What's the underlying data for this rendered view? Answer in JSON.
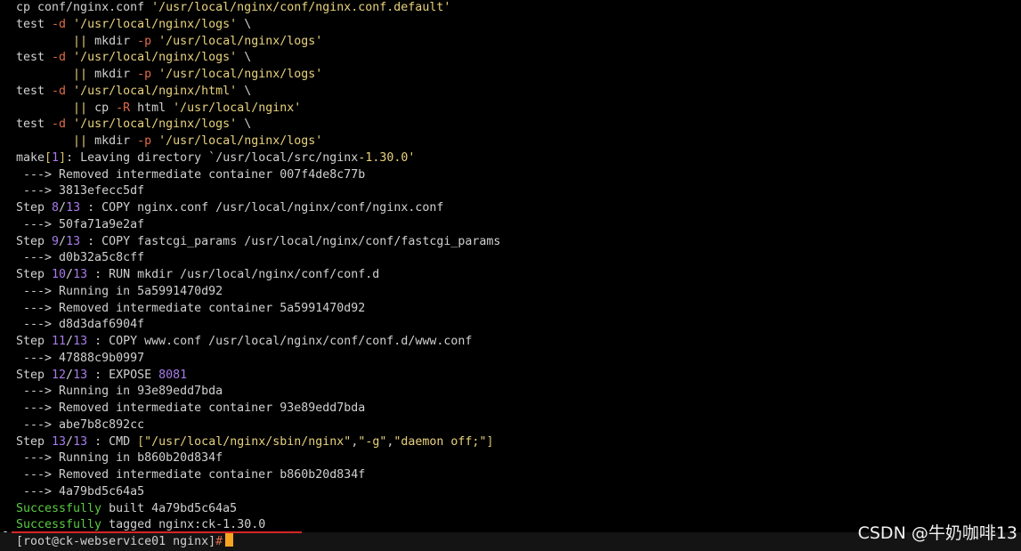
{
  "colors": {
    "default": "#d0d0d0",
    "string": "#e8d27c",
    "flag": "#e06c4a",
    "number": "#a77bea",
    "success": "#5ccb43",
    "bracket": "#d6c36a",
    "cursor": "#f7a521",
    "underline": "#d62525",
    "hostbar": "#141414"
  },
  "terminal": {
    "lines": [
      [
        {
          "t": "cp conf/nginx.conf ",
          "c": "default"
        },
        {
          "t": "'/usr/local/nginx/conf/nginx.conf.default'",
          "c": "string"
        }
      ],
      [
        {
          "t": "test ",
          "c": "default"
        },
        {
          "t": "-d",
          "c": "flag"
        },
        {
          "t": " ",
          "c": "default"
        },
        {
          "t": "'/usr/local/nginx/logs'",
          "c": "string"
        },
        {
          "t": " \\",
          "c": "default"
        }
      ],
      [
        {
          "t": "        ",
          "c": "default"
        },
        {
          "t": "||",
          "c": "string"
        },
        {
          "t": " mkdir ",
          "c": "default"
        },
        {
          "t": "-p",
          "c": "flag"
        },
        {
          "t": " ",
          "c": "default"
        },
        {
          "t": "'/usr/local/nginx/logs'",
          "c": "string"
        }
      ],
      [
        {
          "t": "test ",
          "c": "default"
        },
        {
          "t": "-d",
          "c": "flag"
        },
        {
          "t": " ",
          "c": "default"
        },
        {
          "t": "'/usr/local/nginx/logs'",
          "c": "string"
        },
        {
          "t": " \\",
          "c": "default"
        }
      ],
      [
        {
          "t": "        ",
          "c": "default"
        },
        {
          "t": "||",
          "c": "string"
        },
        {
          "t": " mkdir ",
          "c": "default"
        },
        {
          "t": "-p",
          "c": "flag"
        },
        {
          "t": " ",
          "c": "default"
        },
        {
          "t": "'/usr/local/nginx/logs'",
          "c": "string"
        }
      ],
      [
        {
          "t": "test ",
          "c": "default"
        },
        {
          "t": "-d",
          "c": "flag"
        },
        {
          "t": " ",
          "c": "default"
        },
        {
          "t": "'/usr/local/nginx/html'",
          "c": "string"
        },
        {
          "t": " \\",
          "c": "default"
        }
      ],
      [
        {
          "t": "        ",
          "c": "default"
        },
        {
          "t": "||",
          "c": "string"
        },
        {
          "t": " cp ",
          "c": "default"
        },
        {
          "t": "-R",
          "c": "flag"
        },
        {
          "t": " html ",
          "c": "default"
        },
        {
          "t": "'/usr/local/nginx'",
          "c": "string"
        }
      ],
      [
        {
          "t": "test ",
          "c": "default"
        },
        {
          "t": "-d",
          "c": "flag"
        },
        {
          "t": " ",
          "c": "default"
        },
        {
          "t": "'/usr/local/nginx/logs'",
          "c": "string"
        },
        {
          "t": " \\",
          "c": "default"
        }
      ],
      [
        {
          "t": "        ",
          "c": "default"
        },
        {
          "t": "||",
          "c": "string"
        },
        {
          "t": " mkdir ",
          "c": "default"
        },
        {
          "t": "-p",
          "c": "flag"
        },
        {
          "t": " ",
          "c": "default"
        },
        {
          "t": "'/usr/local/nginx/logs'",
          "c": "string"
        }
      ],
      [
        {
          "t": "make",
          "c": "default"
        },
        {
          "t": "[",
          "c": "bracket"
        },
        {
          "t": "1",
          "c": "number"
        },
        {
          "t": "]",
          "c": "bracket"
        },
        {
          "t": ": Leaving directory `/usr/local/src/nginx",
          "c": "default"
        },
        {
          "t": "-1.30.0",
          "c": "string"
        },
        {
          "t": "'",
          "c": "string"
        }
      ],
      [
        {
          "t": " ---> Removed intermediate container 007f4de8c77b",
          "c": "default"
        }
      ],
      [
        {
          "t": " ---> 3813efecc5df",
          "c": "default"
        }
      ],
      [
        {
          "t": "Step ",
          "c": "default"
        },
        {
          "t": "8",
          "c": "number"
        },
        {
          "t": "/",
          "c": "default"
        },
        {
          "t": "13",
          "c": "number"
        },
        {
          "t": " : COPY nginx.conf /usr/local/nginx/conf/nginx.conf",
          "c": "default"
        }
      ],
      [
        {
          "t": " ---> 50fa71a9e2af",
          "c": "default"
        }
      ],
      [
        {
          "t": "Step ",
          "c": "default"
        },
        {
          "t": "9",
          "c": "number"
        },
        {
          "t": "/",
          "c": "default"
        },
        {
          "t": "13",
          "c": "number"
        },
        {
          "t": " : COPY fastcgi_params /usr/local/nginx/conf/fastcgi_params",
          "c": "default"
        }
      ],
      [
        {
          "t": " ---> d0b32a5c8cff",
          "c": "default"
        }
      ],
      [
        {
          "t": "Step ",
          "c": "default"
        },
        {
          "t": "10",
          "c": "number"
        },
        {
          "t": "/",
          "c": "default"
        },
        {
          "t": "13",
          "c": "number"
        },
        {
          "t": " : RUN mkdir /usr/local/nginx/conf/conf.d",
          "c": "default"
        }
      ],
      [
        {
          "t": " ---> Running in 5a5991470d92",
          "c": "default"
        }
      ],
      [
        {
          "t": " ---> Removed intermediate container 5a5991470d92",
          "c": "default"
        }
      ],
      [
        {
          "t": " ---> d8d3daf6904f",
          "c": "default"
        }
      ],
      [
        {
          "t": "Step ",
          "c": "default"
        },
        {
          "t": "11",
          "c": "number"
        },
        {
          "t": "/",
          "c": "default"
        },
        {
          "t": "13",
          "c": "number"
        },
        {
          "t": " : COPY www.conf /usr/local/nginx/conf/conf.d/www.conf",
          "c": "default"
        }
      ],
      [
        {
          "t": " ---> 47888c9b0997",
          "c": "default"
        }
      ],
      [
        {
          "t": "Step ",
          "c": "default"
        },
        {
          "t": "12",
          "c": "number"
        },
        {
          "t": "/",
          "c": "default"
        },
        {
          "t": "13",
          "c": "number"
        },
        {
          "t": " : EXPOSE ",
          "c": "default"
        },
        {
          "t": "8081",
          "c": "number"
        }
      ],
      [
        {
          "t": " ---> Running in 93e89edd7bda",
          "c": "default"
        }
      ],
      [
        {
          "t": " ---> Removed intermediate container 93e89edd7bda",
          "c": "default"
        }
      ],
      [
        {
          "t": " ---> abe7b8c892cc",
          "c": "default"
        }
      ],
      [
        {
          "t": "Step ",
          "c": "default"
        },
        {
          "t": "13",
          "c": "number"
        },
        {
          "t": "/",
          "c": "default"
        },
        {
          "t": "13",
          "c": "number"
        },
        {
          "t": " : CMD ",
          "c": "default"
        },
        {
          "t": "[",
          "c": "bracket"
        },
        {
          "t": "\"/usr/local/nginx/sbin/nginx\"",
          "c": "string"
        },
        {
          "t": ",",
          "c": "default"
        },
        {
          "t": "\"-g\"",
          "c": "string"
        },
        {
          "t": ",",
          "c": "default"
        },
        {
          "t": "\"daemon off;\"",
          "c": "string"
        },
        {
          "t": "]",
          "c": "bracket"
        }
      ],
      [
        {
          "t": " ---> Running in b860b20d834f",
          "c": "default"
        }
      ],
      [
        {
          "t": " ---> Removed intermediate container b860b20d834f",
          "c": "default"
        }
      ],
      [
        {
          "t": " ---> 4a79bd5c64a5",
          "c": "default"
        }
      ],
      [
        {
          "t": "Successfully",
          "c": "success"
        },
        {
          "t": " built 4a79bd5c64a5",
          "c": "default"
        }
      ],
      [
        {
          "t": "Successfully",
          "c": "success"
        },
        {
          "t": " tagged nginx:ck",
          "c": "default"
        },
        {
          "t": "-1.30.0",
          "c": "default"
        }
      ]
    ],
    "prompt": {
      "text": "[root@ck-webservice01 nginx]",
      "symbol": "#"
    },
    "dash_mark": "-"
  },
  "watermark": "CSDN @牛奶咖啡13"
}
